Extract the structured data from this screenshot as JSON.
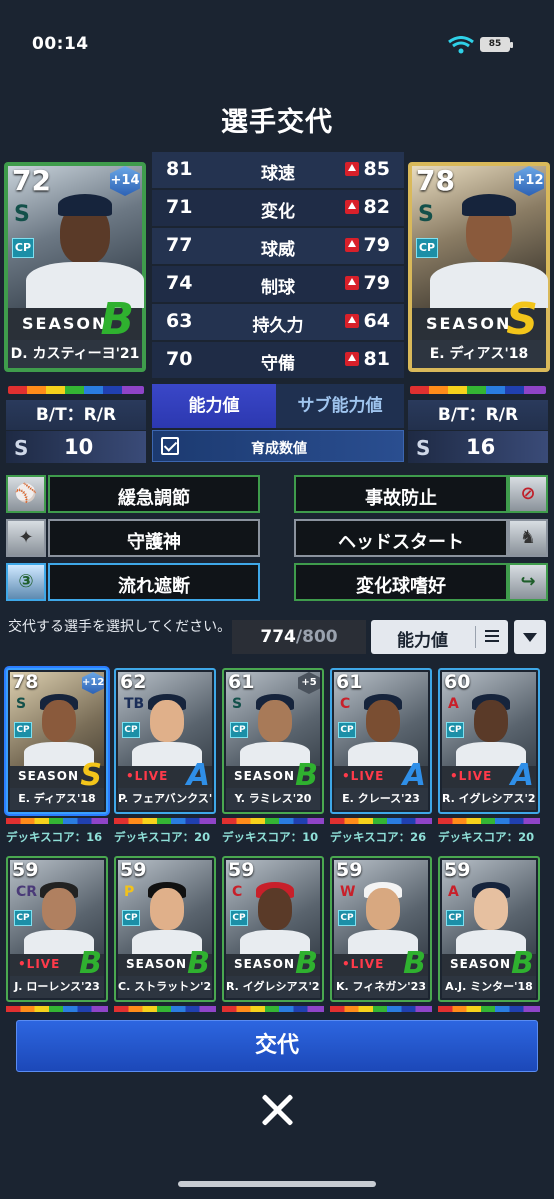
{
  "status": {
    "time": "00:14",
    "battery": "85"
  },
  "title": "選手交代",
  "left_player": {
    "ovr": "72",
    "plus": "+14",
    "cp": "CP",
    "team_logo": "S",
    "series": "SEASON",
    "grade": "B",
    "name": "D. カスティーヨ'21",
    "bt": "B/T：R/R",
    "s_icon": "S",
    "s_value": "10",
    "grade_color": "#2fb12f"
  },
  "right_player": {
    "ovr": "78",
    "plus": "+12",
    "cp": "CP",
    "team_logo": "S",
    "series": "SEASON",
    "grade": "S",
    "name": "E. ディアス'18",
    "bt": "B/T：R/R",
    "s_icon": "S",
    "s_value": "16",
    "grade_color": "#f3c51a"
  },
  "stats": [
    {
      "left": "81",
      "label": "球速",
      "right": "85"
    },
    {
      "left": "71",
      "label": "変化",
      "right": "82"
    },
    {
      "left": "77",
      "label": "球威",
      "right": "79"
    },
    {
      "left": "74",
      "label": "制球",
      "right": "79"
    },
    {
      "left": "63",
      "label": "持久力",
      "right": "64"
    },
    {
      "left": "70",
      "label": "守備",
      "right": "81"
    }
  ],
  "tabs": {
    "ability": "能力値",
    "sub_ability": "サブ能力値"
  },
  "growth_label": "育成数値",
  "skills_left": [
    {
      "label": "緩急調節",
      "icon": "pitcher-icon"
    },
    {
      "label": "守護神",
      "icon": "wings-icon"
    },
    {
      "label": "流れ遮断",
      "icon": "shield-3-icon"
    }
  ],
  "skills_right": [
    {
      "label": "事故防止",
      "icon": "no-injury-icon"
    },
    {
      "label": "ヘッドスタート",
      "icon": "runner-icon"
    },
    {
      "label": "変化球嗜好",
      "icon": "curveball-icon"
    }
  ],
  "select_note": "交代する選手を選択してください。",
  "score": {
    "current": "774",
    "sep": "/",
    "max": "800"
  },
  "sort_label": "能力値",
  "close_symbol": "✕",
  "cards_row1": [
    {
      "ovr": "78",
      "plus": "+12",
      "logo": "S",
      "series": "SEASON",
      "grade": "S",
      "name": "E. ディアス'18",
      "deck": "デッキスコア：16",
      "live": false
    },
    {
      "ovr": "62",
      "plus": "",
      "logo": "TB",
      "series": "•LIVE",
      "grade": "A",
      "name": "P. フェアバンクス'23",
      "deck": "デッキスコア：20",
      "live": true
    },
    {
      "ovr": "61",
      "plus": "+5",
      "logo": "S",
      "series": "SEASON",
      "grade": "B",
      "name": "Y. ラミレス'20",
      "deck": "デッキスコア：10",
      "live": false
    },
    {
      "ovr": "61",
      "plus": "",
      "logo": "C",
      "series": "•LIVE",
      "grade": "A",
      "name": "E. クレース'23",
      "deck": "デッキスコア：26",
      "live": true
    },
    {
      "ovr": "60",
      "plus": "",
      "logo": "A",
      "series": "•LIVE",
      "grade": "A",
      "name": "R. イグレシアス'23",
      "deck": "デッキスコア：20",
      "live": true
    }
  ],
  "cards_row2": [
    {
      "ovr": "59",
      "logo": "CR",
      "series": "•LIVE",
      "grade": "B",
      "name": "J. ローレンス'23",
      "live": true
    },
    {
      "ovr": "59",
      "logo": "P",
      "series": "SEASON",
      "grade": "B",
      "name": "C. ストラットン'21",
      "live": false
    },
    {
      "ovr": "59",
      "logo": "C",
      "series": "SEASON",
      "grade": "B",
      "name": "R. イグレシアス'20",
      "live": false
    },
    {
      "ovr": "59",
      "logo": "W",
      "series": "•LIVE",
      "grade": "B",
      "name": "K. フィネガン'23",
      "live": true
    },
    {
      "ovr": "59",
      "logo": "A",
      "series": "SEASON",
      "grade": "B",
      "name": "A.J. ミンター'18",
      "live": false
    }
  ],
  "swap_button": "交代",
  "colors": {
    "grade_s": "#f3c51a",
    "grade_a": "#2f8fe8",
    "grade_b": "#2fb12f",
    "live_red": "#ff3a4a",
    "accent_blue": "#2d66e0"
  }
}
